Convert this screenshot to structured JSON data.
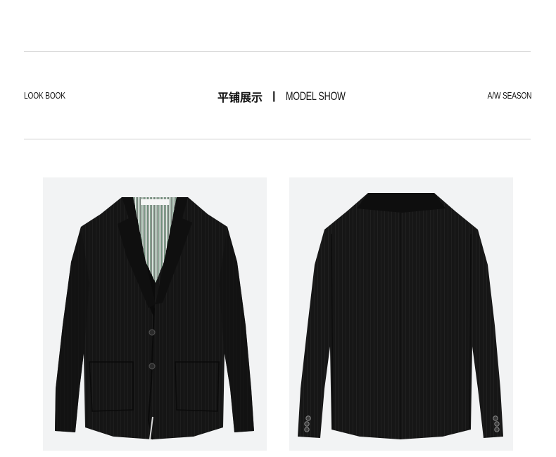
{
  "header": {
    "left_label": "LOOK BOOK",
    "center_cn": "平铺展示",
    "center_separator": "|",
    "center_en": "MODEL SHOW",
    "right_label": "A/W SEASON"
  },
  "colors": {
    "rule": "#cfcfcf",
    "photo_bg": "#f2f3f4",
    "jacket": "#141414",
    "lining_stripe": "#6f8f7b"
  },
  "photos": [
    {
      "view": "front",
      "subject": "black blazer front"
    },
    {
      "view": "back",
      "subject": "black blazer back"
    }
  ]
}
